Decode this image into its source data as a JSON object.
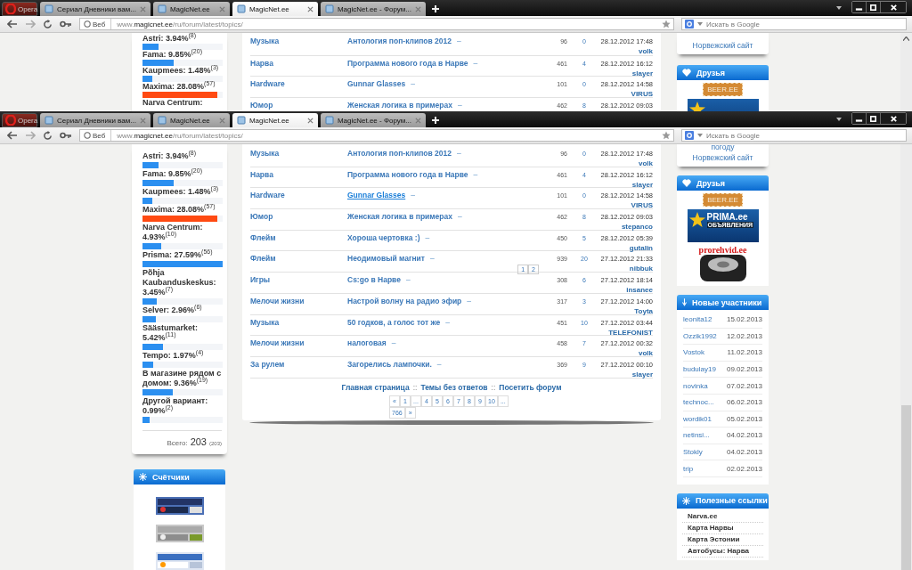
{
  "windows": [
    {
      "kind": "background",
      "menu_label": "Opera",
      "tabs": [
        {
          "title": "Сериал Дневники вам...",
          "selected": false
        },
        {
          "title": "MagicNet.ee",
          "selected": false
        },
        {
          "title": "MagicNet.ee",
          "selected": true
        },
        {
          "title": "MagicNet.ee - Форум...",
          "selected": false
        }
      ],
      "address": {
        "badge": "Веб",
        "url": "www.**magicnet.ee**/ru/forum/latest/topics/"
      },
      "search": {
        "placeholder": "Искать в Google"
      },
      "poll": {
        "items": [
          {
            "label": "Astri: 3.94%$^{(8)}$",
            "level": 0.2,
            "color": "#2b8ff0"
          },
          {
            "label": "Fama: 9.85%$^{(20)}$",
            "level": 0.39,
            "color": "#2b8ff0"
          },
          {
            "label": "Kaupmees: 1.48%$^{(3)}$",
            "level": 0.12,
            "color": "#2b8ff0"
          },
          {
            "label": "Maxima: 28.08%$^{(57)}$",
            "level": 0.93,
            "color": "#ff4a12"
          },
          {
            "label": "Narva Centrum:"
          }
        ]
      },
      "topics": [
        {
          "forum": "Музыка",
          "title": "Антология поп-клипов 2012",
          "goto": "–",
          "views": "96",
          "replies": "0",
          "date": "28.12.2012 17:48",
          "user": "volk",
          "hovered": false
        },
        {
          "forum": "Нарва",
          "title": "Программа нового года в Нарве",
          "goto": "–",
          "views": "461",
          "replies": "4",
          "date": "28.12.2012 16:12",
          "user": "slayer",
          "hovered": false
        },
        {
          "forum": "Hardware",
          "title": "Gunnar Glasses",
          "goto": "–",
          "views": "101",
          "replies": "0",
          "date": "28.12.2012 14:58",
          "user": "VIRUS",
          "hovered": false
        },
        {
          "forum": "Юмор",
          "title": "Женская логика в примерах",
          "goto": "–",
          "views": "462",
          "replies": "8",
          "date": "28.12.2012 09:03",
          "hovered": false
        }
      ],
      "right": [
        {
          "kind": "info",
          "links": [
            "Норвежский сайт"
          ]
        },
        {
          "kind": "friends",
          "title": "Друзья",
          "banners": [
            {
              "kind": "beer",
              "text": "BEER.EE"
            },
            {
              "kind": "prima"
            }
          ]
        }
      ]
    },
    {
      "kind": "front",
      "menu_label": "Opera",
      "tabs": [
        {
          "title": "Сериал Дневники вам...",
          "selected": false
        },
        {
          "title": "MagicNet.ee",
          "selected": false
        },
        {
          "title": "MagicNet.ee",
          "selected": true
        },
        {
          "title": "MagicNet.ee - Форум...",
          "selected": false
        }
      ],
      "address": {
        "badge": "Веб",
        "url": "www.**magicnet.ee**/ru/forum/latest/topics/"
      },
      "search": {
        "placeholder": "Искать в Google"
      },
      "poll": {
        "items": [
          {
            "label": "Astri: 3.94%$^{(8)}$",
            "level": 0.2,
            "color": "#2b8ff0"
          },
          {
            "label": "Fama: 9.85%$^{(20)}$",
            "level": 0.39,
            "color": "#2b8ff0"
          },
          {
            "label": "Kaupmees: 1.48%$^{(3)}$",
            "level": 0.12,
            "color": "#2b8ff0"
          },
          {
            "label": "Maxima: 28.08%$^{(57)}$",
            "level": 0.93,
            "color": "#ff4a12"
          },
          {
            "label": "Narva Centrum: 4.93%$^{(10)}$",
            "level": 0.23,
            "color": "#2b8ff0"
          },
          {
            "label": "Prisma: 27.59%$^{(56)}$",
            "level": 1.0,
            "color": "#2b8ff0"
          },
          {
            "label": "Põhja Kaubanduskeskus: 3.45%$^{(7)}$",
            "level": 0.18,
            "color": "#2b8ff0"
          },
          {
            "label": "Selver: 2.96%$^{(6)}$",
            "level": 0.17,
            "color": "#2b8ff0"
          },
          {
            "label": "Säästumarket: 5.42%$^{(11)}$",
            "level": 0.25,
            "color": "#2b8ff0"
          },
          {
            "label": "Tempo: 1.97%$^{(4)}$",
            "level": 0.13,
            "color": "#2b8ff0"
          },
          {
            "label": "В магазине рядом с домом: 9.36%$^{(19)}$",
            "level": 0.38,
            "color": "#2b8ff0"
          },
          {
            "label": "Другой вариант: 0.99%$^{(2)}$",
            "level": 0.09,
            "color": "#2b8ff0"
          }
        ],
        "total": {
          "label": "Всего:",
          "value": "203",
          "count": "(203)"
        }
      },
      "counters": {
        "title": "Счётчики"
      },
      "topics": [
        {
          "forum": "Музыка",
          "title": "Антология поп-клипов 2012",
          "goto": "–",
          "views": "96",
          "replies": "0",
          "date": "28.12.2012 17:48",
          "user": "volk",
          "hovered": false
        },
        {
          "forum": "Нарва",
          "title": "Программа нового года в Нарве",
          "goto": "–",
          "views": "461",
          "replies": "4",
          "date": "28.12.2012 16:12",
          "user": "slayer",
          "hovered": false
        },
        {
          "forum": "Hardware",
          "title": "Gunnar Glasses",
          "goto": "–",
          "views": "101",
          "replies": "0",
          "date": "28.12.2012 14:58",
          "user": "VIRUS",
          "hovered": true
        },
        {
          "forum": "Юмор",
          "title": "Женская логика в примерах",
          "goto": "–",
          "views": "462",
          "replies": "8",
          "date": "28.12.2012 09:03",
          "user": "stepanco",
          "hovered": false
        },
        {
          "forum": "Флейм",
          "title": "Хороша чертовка :)",
          "goto": "–",
          "views": "450",
          "replies": "5",
          "date": "28.12.2012 05:39",
          "user": "gutalin",
          "hovered": false
        },
        {
          "forum": "Флейм",
          "title": "Неодимовый магнит",
          "goto": "–",
          "views": "939",
          "replies": "20",
          "date": "27.12.2012 21:33",
          "user": "nibbuk",
          "hovered": false,
          "pages": [
            "1",
            "2"
          ]
        },
        {
          "forum": "Игры",
          "title": "Cs:go в Нарве",
          "goto": "–",
          "views": "308",
          "replies": "6",
          "date": "27.12.2012 18:14",
          "user": "insanee",
          "hovered": false
        },
        {
          "forum": "Мелочи жизни",
          "title": "Настрой волну на радио эфир",
          "goto": "–",
          "views": "317",
          "replies": "3",
          "date": "27.12.2012 14:00",
          "user": "Toyta",
          "hovered": false
        },
        {
          "forum": "Музыка",
          "title": "50 годков, а голос тот же",
          "goto": "–",
          "views": "451",
          "replies": "10",
          "date": "27.12.2012 03:44",
          "user": "TELEFONIST",
          "hovered": false
        },
        {
          "forum": "Мелочи жизни",
          "title": "налоговая",
          "goto": "–",
          "views": "458",
          "replies": "7",
          "date": "27.12.2012 00:32",
          "user": "volk",
          "hovered": false
        },
        {
          "forum": "За рулем",
          "title": "Загорелись лампочки.",
          "goto": "–",
          "views": "369",
          "replies": "9",
          "date": "27.12.2012 00:10",
          "user": "slayer",
          "hovered": false
        }
      ],
      "footer_links": [
        {
          "kind": "link",
          "text": "Главная страница"
        },
        {
          "kind": "sep",
          "text": "::"
        },
        {
          "kind": "link",
          "text": "Темы без ответов"
        },
        {
          "kind": "sep",
          "text": "::"
        },
        {
          "kind": "link",
          "text": "Посетить форум"
        }
      ],
      "pagination": [
        "«",
        "1",
        "...",
        "4",
        "5",
        "6",
        "7",
        "8",
        "9",
        "10",
        "...",
        "766",
        "»"
      ],
      "right": [
        {
          "kind": "info",
          "links": [
            "погоду",
            "Норвежский сайт"
          ]
        },
        {
          "kind": "friends",
          "title": "Друзья",
          "banners": [
            {
              "kind": "beer",
              "text": "BEER.EE"
            },
            {
              "kind": "prima",
              "text": "PRIMA.ee",
              "subtext": "ОБЪЯВЛЕНИЯ"
            },
            {
              "kind": "tire",
              "text": "prorehvid.ee"
            }
          ]
        },
        {
          "kind": "members",
          "title": "Новые участники",
          "members": [
            {
              "name": "leonita12",
              "date": "15.02.2013"
            },
            {
              "name": "Ozzik1992",
              "date": "12.02.2013"
            },
            {
              "name": "Vostok",
              "date": "11.02.2013"
            },
            {
              "name": "budulay19",
              "date": "09.02.2013"
            },
            {
              "name": "novinka",
              "date": "07.02.2013"
            },
            {
              "name": "technoc...",
              "date": "06.02.2013"
            },
            {
              "name": "wordik01",
              "date": "05.02.2013"
            },
            {
              "name": "netinsi...",
              "date": "04.02.2013"
            },
            {
              "name": "Stokly",
              "date": "04.02.2013"
            },
            {
              "name": "trip",
              "date": "02.02.2013"
            }
          ]
        },
        {
          "kind": "useful",
          "title": "Полезные ссылки",
          "links": [
            "Narva.ee",
            "Карта Нарвы",
            "Карта Эстонии",
            "Автобусы: Нарва"
          ]
        }
      ]
    }
  ]
}
